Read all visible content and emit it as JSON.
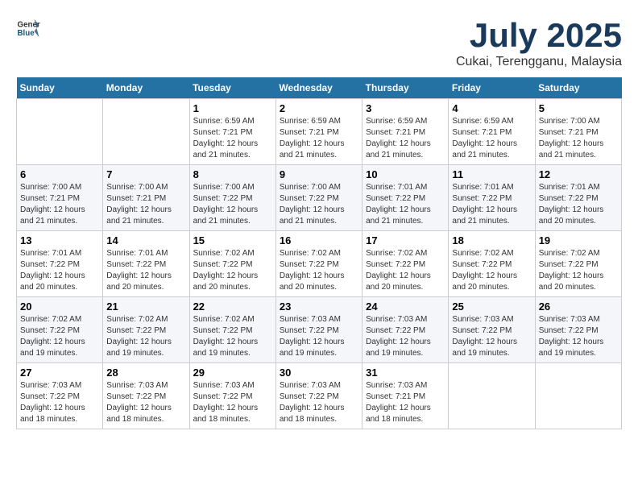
{
  "header": {
    "logo_general": "General",
    "logo_blue": "Blue",
    "month_title": "July 2025",
    "location": "Cukai, Terengganu, Malaysia"
  },
  "days_of_week": [
    "Sunday",
    "Monday",
    "Tuesday",
    "Wednesday",
    "Thursday",
    "Friday",
    "Saturday"
  ],
  "weeks": [
    [
      {
        "day": "",
        "sunrise": "",
        "sunset": "",
        "daylight": ""
      },
      {
        "day": "",
        "sunrise": "",
        "sunset": "",
        "daylight": ""
      },
      {
        "day": "1",
        "sunrise": "Sunrise: 6:59 AM",
        "sunset": "Sunset: 7:21 PM",
        "daylight": "Daylight: 12 hours and 21 minutes."
      },
      {
        "day": "2",
        "sunrise": "Sunrise: 6:59 AM",
        "sunset": "Sunset: 7:21 PM",
        "daylight": "Daylight: 12 hours and 21 minutes."
      },
      {
        "day": "3",
        "sunrise": "Sunrise: 6:59 AM",
        "sunset": "Sunset: 7:21 PM",
        "daylight": "Daylight: 12 hours and 21 minutes."
      },
      {
        "day": "4",
        "sunrise": "Sunrise: 6:59 AM",
        "sunset": "Sunset: 7:21 PM",
        "daylight": "Daylight: 12 hours and 21 minutes."
      },
      {
        "day": "5",
        "sunrise": "Sunrise: 7:00 AM",
        "sunset": "Sunset: 7:21 PM",
        "daylight": "Daylight: 12 hours and 21 minutes."
      }
    ],
    [
      {
        "day": "6",
        "sunrise": "Sunrise: 7:00 AM",
        "sunset": "Sunset: 7:21 PM",
        "daylight": "Daylight: 12 hours and 21 minutes."
      },
      {
        "day": "7",
        "sunrise": "Sunrise: 7:00 AM",
        "sunset": "Sunset: 7:21 PM",
        "daylight": "Daylight: 12 hours and 21 minutes."
      },
      {
        "day": "8",
        "sunrise": "Sunrise: 7:00 AM",
        "sunset": "Sunset: 7:22 PM",
        "daylight": "Daylight: 12 hours and 21 minutes."
      },
      {
        "day": "9",
        "sunrise": "Sunrise: 7:00 AM",
        "sunset": "Sunset: 7:22 PM",
        "daylight": "Daylight: 12 hours and 21 minutes."
      },
      {
        "day": "10",
        "sunrise": "Sunrise: 7:01 AM",
        "sunset": "Sunset: 7:22 PM",
        "daylight": "Daylight: 12 hours and 21 minutes."
      },
      {
        "day": "11",
        "sunrise": "Sunrise: 7:01 AM",
        "sunset": "Sunset: 7:22 PM",
        "daylight": "Daylight: 12 hours and 21 minutes."
      },
      {
        "day": "12",
        "sunrise": "Sunrise: 7:01 AM",
        "sunset": "Sunset: 7:22 PM",
        "daylight": "Daylight: 12 hours and 20 minutes."
      }
    ],
    [
      {
        "day": "13",
        "sunrise": "Sunrise: 7:01 AM",
        "sunset": "Sunset: 7:22 PM",
        "daylight": "Daylight: 12 hours and 20 minutes."
      },
      {
        "day": "14",
        "sunrise": "Sunrise: 7:01 AM",
        "sunset": "Sunset: 7:22 PM",
        "daylight": "Daylight: 12 hours and 20 minutes."
      },
      {
        "day": "15",
        "sunrise": "Sunrise: 7:02 AM",
        "sunset": "Sunset: 7:22 PM",
        "daylight": "Daylight: 12 hours and 20 minutes."
      },
      {
        "day": "16",
        "sunrise": "Sunrise: 7:02 AM",
        "sunset": "Sunset: 7:22 PM",
        "daylight": "Daylight: 12 hours and 20 minutes."
      },
      {
        "day": "17",
        "sunrise": "Sunrise: 7:02 AM",
        "sunset": "Sunset: 7:22 PM",
        "daylight": "Daylight: 12 hours and 20 minutes."
      },
      {
        "day": "18",
        "sunrise": "Sunrise: 7:02 AM",
        "sunset": "Sunset: 7:22 PM",
        "daylight": "Daylight: 12 hours and 20 minutes."
      },
      {
        "day": "19",
        "sunrise": "Sunrise: 7:02 AM",
        "sunset": "Sunset: 7:22 PM",
        "daylight": "Daylight: 12 hours and 20 minutes."
      }
    ],
    [
      {
        "day": "20",
        "sunrise": "Sunrise: 7:02 AM",
        "sunset": "Sunset: 7:22 PM",
        "daylight": "Daylight: 12 hours and 19 minutes."
      },
      {
        "day": "21",
        "sunrise": "Sunrise: 7:02 AM",
        "sunset": "Sunset: 7:22 PM",
        "daylight": "Daylight: 12 hours and 19 minutes."
      },
      {
        "day": "22",
        "sunrise": "Sunrise: 7:02 AM",
        "sunset": "Sunset: 7:22 PM",
        "daylight": "Daylight: 12 hours and 19 minutes."
      },
      {
        "day": "23",
        "sunrise": "Sunrise: 7:03 AM",
        "sunset": "Sunset: 7:22 PM",
        "daylight": "Daylight: 12 hours and 19 minutes."
      },
      {
        "day": "24",
        "sunrise": "Sunrise: 7:03 AM",
        "sunset": "Sunset: 7:22 PM",
        "daylight": "Daylight: 12 hours and 19 minutes."
      },
      {
        "day": "25",
        "sunrise": "Sunrise: 7:03 AM",
        "sunset": "Sunset: 7:22 PM",
        "daylight": "Daylight: 12 hours and 19 minutes."
      },
      {
        "day": "26",
        "sunrise": "Sunrise: 7:03 AM",
        "sunset": "Sunset: 7:22 PM",
        "daylight": "Daylight: 12 hours and 19 minutes."
      }
    ],
    [
      {
        "day": "27",
        "sunrise": "Sunrise: 7:03 AM",
        "sunset": "Sunset: 7:22 PM",
        "daylight": "Daylight: 12 hours and 18 minutes."
      },
      {
        "day": "28",
        "sunrise": "Sunrise: 7:03 AM",
        "sunset": "Sunset: 7:22 PM",
        "daylight": "Daylight: 12 hours and 18 minutes."
      },
      {
        "day": "29",
        "sunrise": "Sunrise: 7:03 AM",
        "sunset": "Sunset: 7:22 PM",
        "daylight": "Daylight: 12 hours and 18 minutes."
      },
      {
        "day": "30",
        "sunrise": "Sunrise: 7:03 AM",
        "sunset": "Sunset: 7:22 PM",
        "daylight": "Daylight: 12 hours and 18 minutes."
      },
      {
        "day": "31",
        "sunrise": "Sunrise: 7:03 AM",
        "sunset": "Sunset: 7:21 PM",
        "daylight": "Daylight: 12 hours and 18 minutes."
      },
      {
        "day": "",
        "sunrise": "",
        "sunset": "",
        "daylight": ""
      },
      {
        "day": "",
        "sunrise": "",
        "sunset": "",
        "daylight": ""
      }
    ]
  ]
}
